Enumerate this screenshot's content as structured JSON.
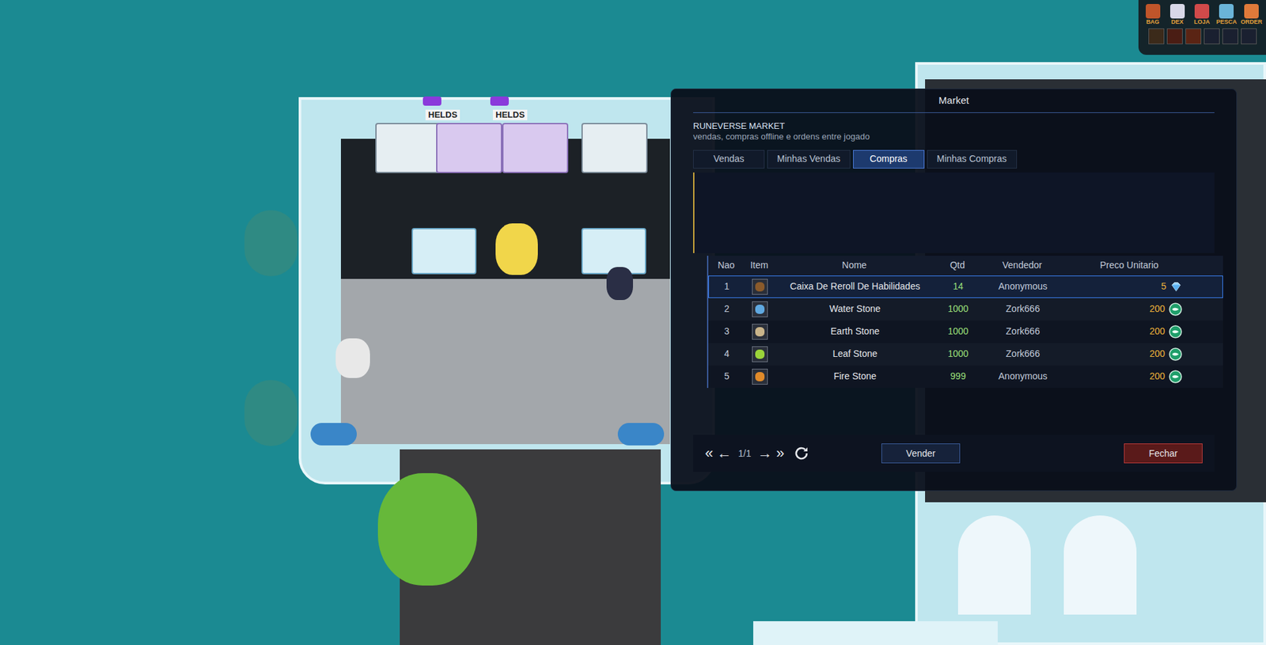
{
  "hud": {
    "labels": [
      "BAG",
      "DEX",
      "LOJA",
      "PESCA",
      "ORDER"
    ]
  },
  "world": {
    "signs": [
      "HELDS",
      "HELDS"
    ]
  },
  "window": {
    "title": "Market",
    "heading": "RUNEVERSE MARKET",
    "subtitle": "vendas, compras offline e ordens entre jogado"
  },
  "tabs": [
    {
      "label": "Vendas",
      "selected": false
    },
    {
      "label": "Minhas Vendas",
      "selected": false
    },
    {
      "label": "Compras",
      "selected": true
    },
    {
      "label": "Minhas Compras",
      "selected": false
    }
  ],
  "table": {
    "columns": [
      "Nao",
      "Item",
      "Nome",
      "Qtd",
      "Vendedor",
      "Preco Unitario"
    ],
    "rows": [
      {
        "no": "1",
        "name": "Caixa De Reroll De Habilidades",
        "qty": "14",
        "seller": "Anonymous",
        "price": "5",
        "kind": "diamond",
        "color": "#8a5a2b",
        "selected": true
      },
      {
        "no": "2",
        "name": "Water Stone",
        "qty": "1000",
        "seller": "Zork666",
        "price": "200",
        "kind": "coin",
        "color": "#5fa8e0",
        "selected": false
      },
      {
        "no": "3",
        "name": "Earth Stone",
        "qty": "1000",
        "seller": "Zork666",
        "price": "200",
        "kind": "coin",
        "color": "#c9b48a",
        "selected": false
      },
      {
        "no": "4",
        "name": "Leaf Stone",
        "qty": "1000",
        "seller": "Zork666",
        "price": "200",
        "kind": "coin",
        "color": "#9bd43a",
        "selected": false
      },
      {
        "no": "5",
        "name": "Fire Stone",
        "qty": "999",
        "seller": "Anonymous",
        "price": "200",
        "kind": "coin",
        "color": "#e08a2a",
        "selected": false
      }
    ]
  },
  "pagination": {
    "first": "«",
    "prev": "←",
    "page": "1/1",
    "next": "→",
    "last": "»"
  },
  "buttons": [
    {
      "label": "Vender",
      "kind": "primary"
    },
    {
      "label": "Fechar",
      "kind": "danger"
    }
  ]
}
